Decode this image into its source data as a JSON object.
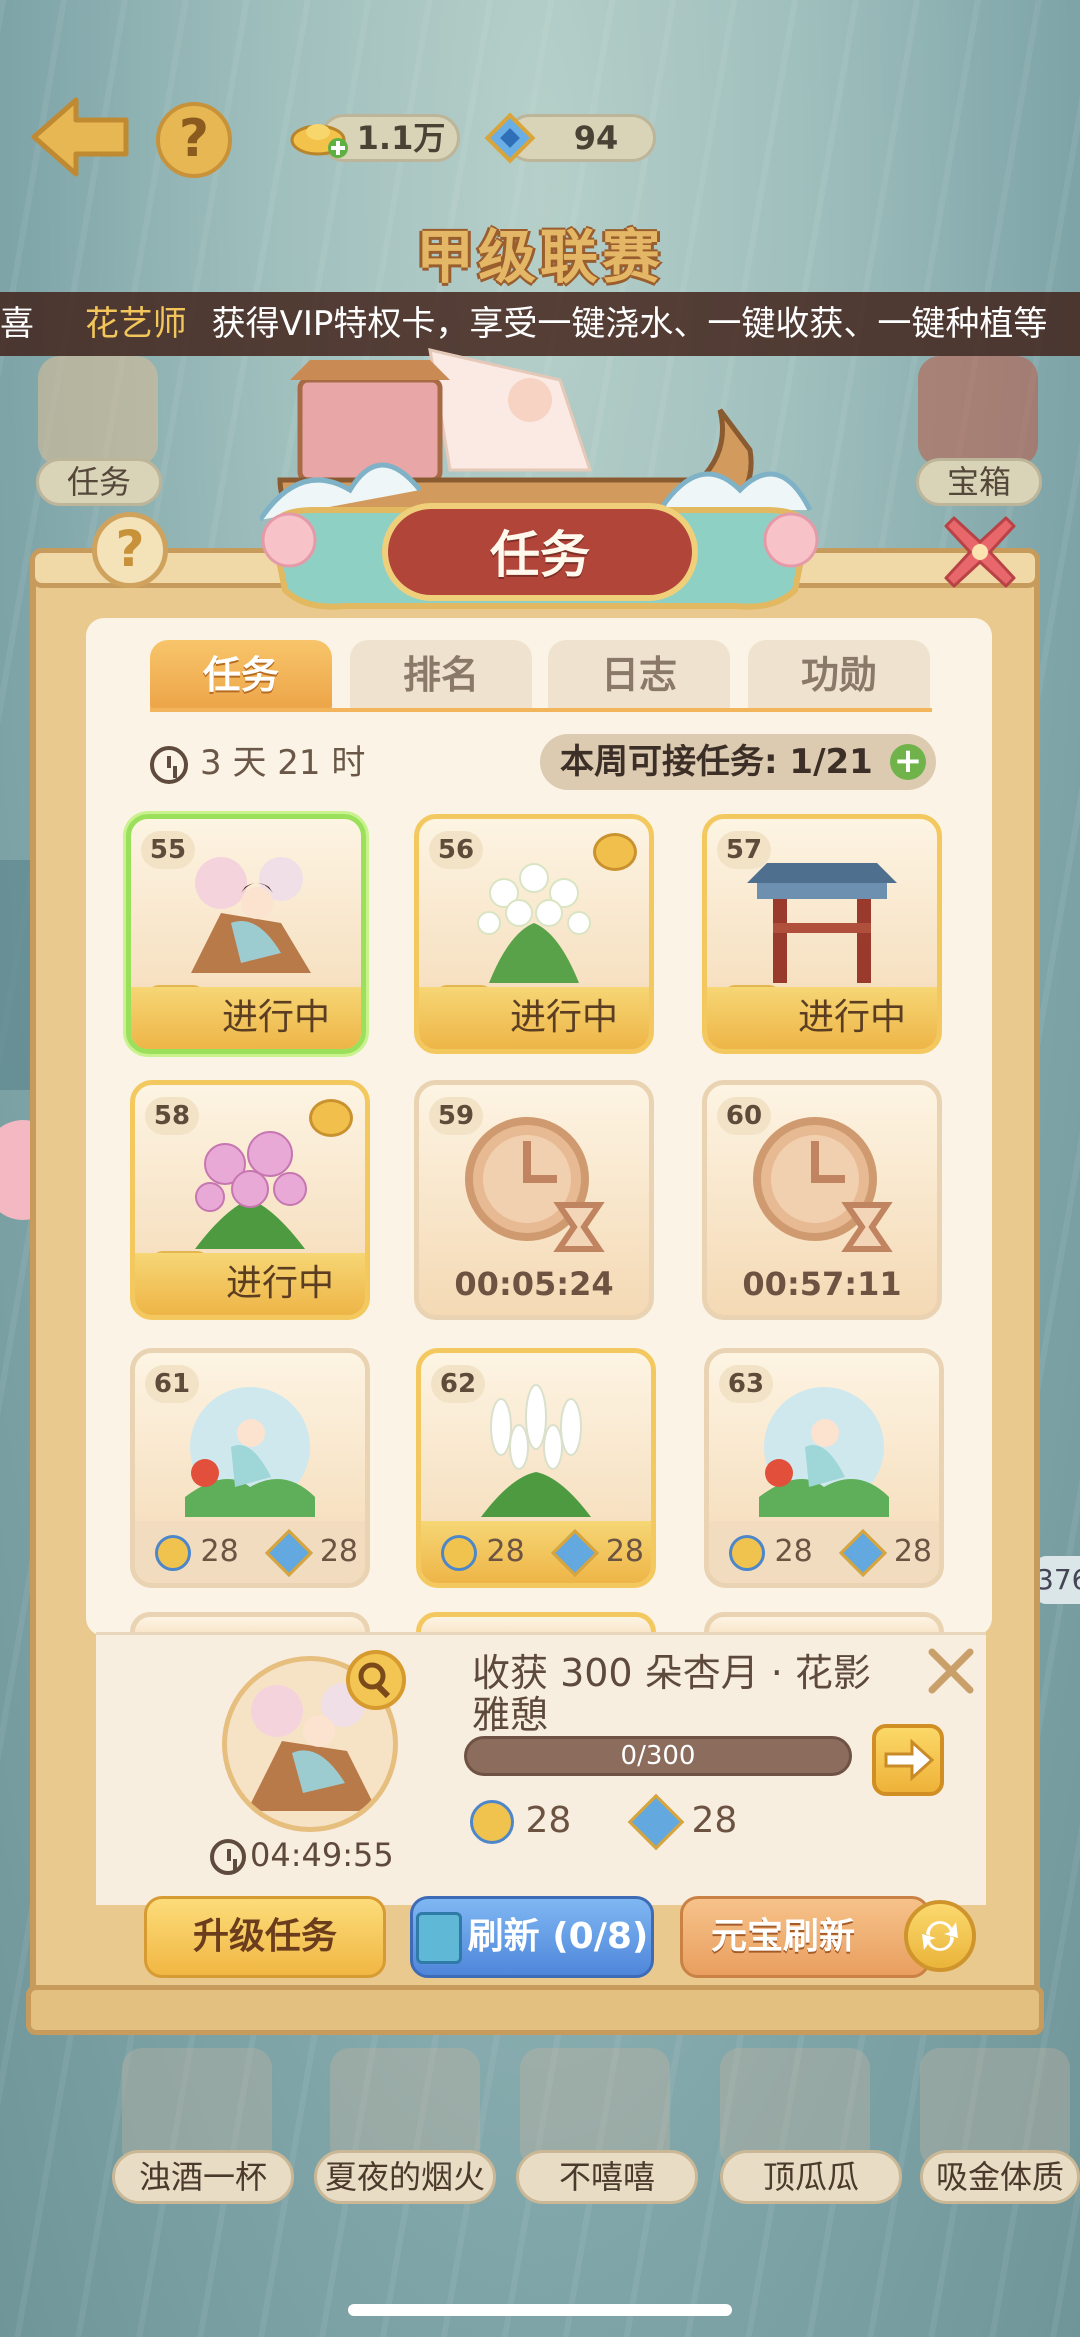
{
  "top_bar": {
    "gold_amount": "1.1万",
    "diamond_amount": "94",
    "league_title": "甲级联赛"
  },
  "marquee": {
    "prefix": "喜",
    "name": "花艺师",
    "message": "获得VIP特权卡，享受一键浇水、一键收获、一键种植等"
  },
  "top_icons": [
    {
      "label": "任务"
    },
    {
      "label": "宝箱"
    }
  ],
  "panel": {
    "title": "任务",
    "tabs": [
      "任务",
      "排名",
      "日志",
      "功勋"
    ],
    "time_left": "3 天 21 时",
    "weekly_label": "本周可接任务: 1/21"
  },
  "tasks": [
    {
      "num": "55",
      "status": "进行中"
    },
    {
      "num": "56",
      "status": "进行中"
    },
    {
      "num": "57",
      "status": "进行中"
    },
    {
      "num": "58",
      "status": "进行中"
    },
    {
      "num": "59",
      "timer": "00:05:24"
    },
    {
      "num": "60",
      "timer": "00:57:11"
    },
    {
      "num": "61",
      "compass": "28",
      "gem": "28"
    },
    {
      "num": "62",
      "compass": "28",
      "gem": "28"
    },
    {
      "num": "63",
      "compass": "28",
      "gem": "28"
    }
  ],
  "detail": {
    "title": "收获 300 朵杏月 · 花影雅憩",
    "progress_text": "0/300",
    "progress": 0,
    "timer": "04:49:55",
    "compass": "28",
    "gem": "28"
  },
  "buttons": {
    "upgrade": "升级任务",
    "refresh": "刷新 (0/8)",
    "yuanbao_refresh": "元宝刷新"
  },
  "bottom_tiles": [
    "浊酒一杯",
    "夏夜的烟火",
    "不嘻嘻",
    "顶瓜瓜",
    "吸金体质"
  ],
  "side_fragments": {
    "right_number": "376"
  },
  "colors": {
    "accent_gold": "#f1b743",
    "progress_brown": "#8b6c5d",
    "refresh_blue": "#4f86da",
    "title_red": "#b2453a"
  }
}
